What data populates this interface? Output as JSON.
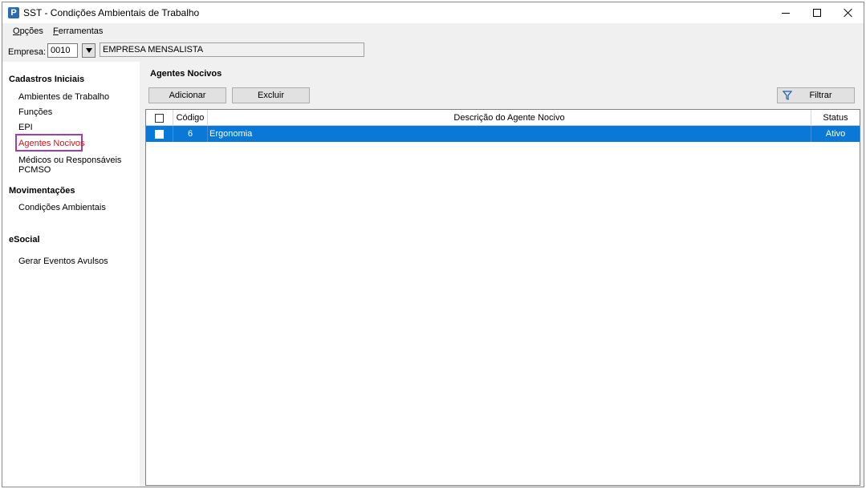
{
  "window": {
    "app_icon_letter": "P",
    "title": "SST - Condições Ambientais de Trabalho"
  },
  "menu": {
    "items": [
      "Opções",
      "Ferramentas"
    ]
  },
  "empresa": {
    "label": "Empresa:",
    "code": "0010",
    "name": "EMPRESA MENSALISTA"
  },
  "sidebar": {
    "sections": [
      {
        "title": "Cadastros Iniciais",
        "items": [
          "Ambientes de Trabalho",
          "Funções",
          "EPI",
          "Agentes Nocivos",
          "Médicos ou Responsáveis PCMSO"
        ]
      },
      {
        "title": "Movimentações",
        "items": [
          "Condições Ambientais"
        ]
      },
      {
        "title": "eSocial",
        "items": [
          "Gerar Eventos Avulsos"
        ]
      }
    ],
    "active_item": "Agentes Nocivos",
    "active_color": "#e01010",
    "highlight_color": "#9b3fb3"
  },
  "main": {
    "title": "Agentes Nocivos",
    "buttons": {
      "add": "Adicionar",
      "delete": "Excluir",
      "filter": "Filtrar"
    },
    "table": {
      "columns": [
        "Código",
        "Descrição do Agente Nocivo",
        "Status"
      ],
      "rows": [
        {
          "codigo": "6",
          "descricao": "Ergonomia",
          "status": "Ativo",
          "selected": true
        }
      ],
      "selection_color": "#0a78d7"
    }
  }
}
